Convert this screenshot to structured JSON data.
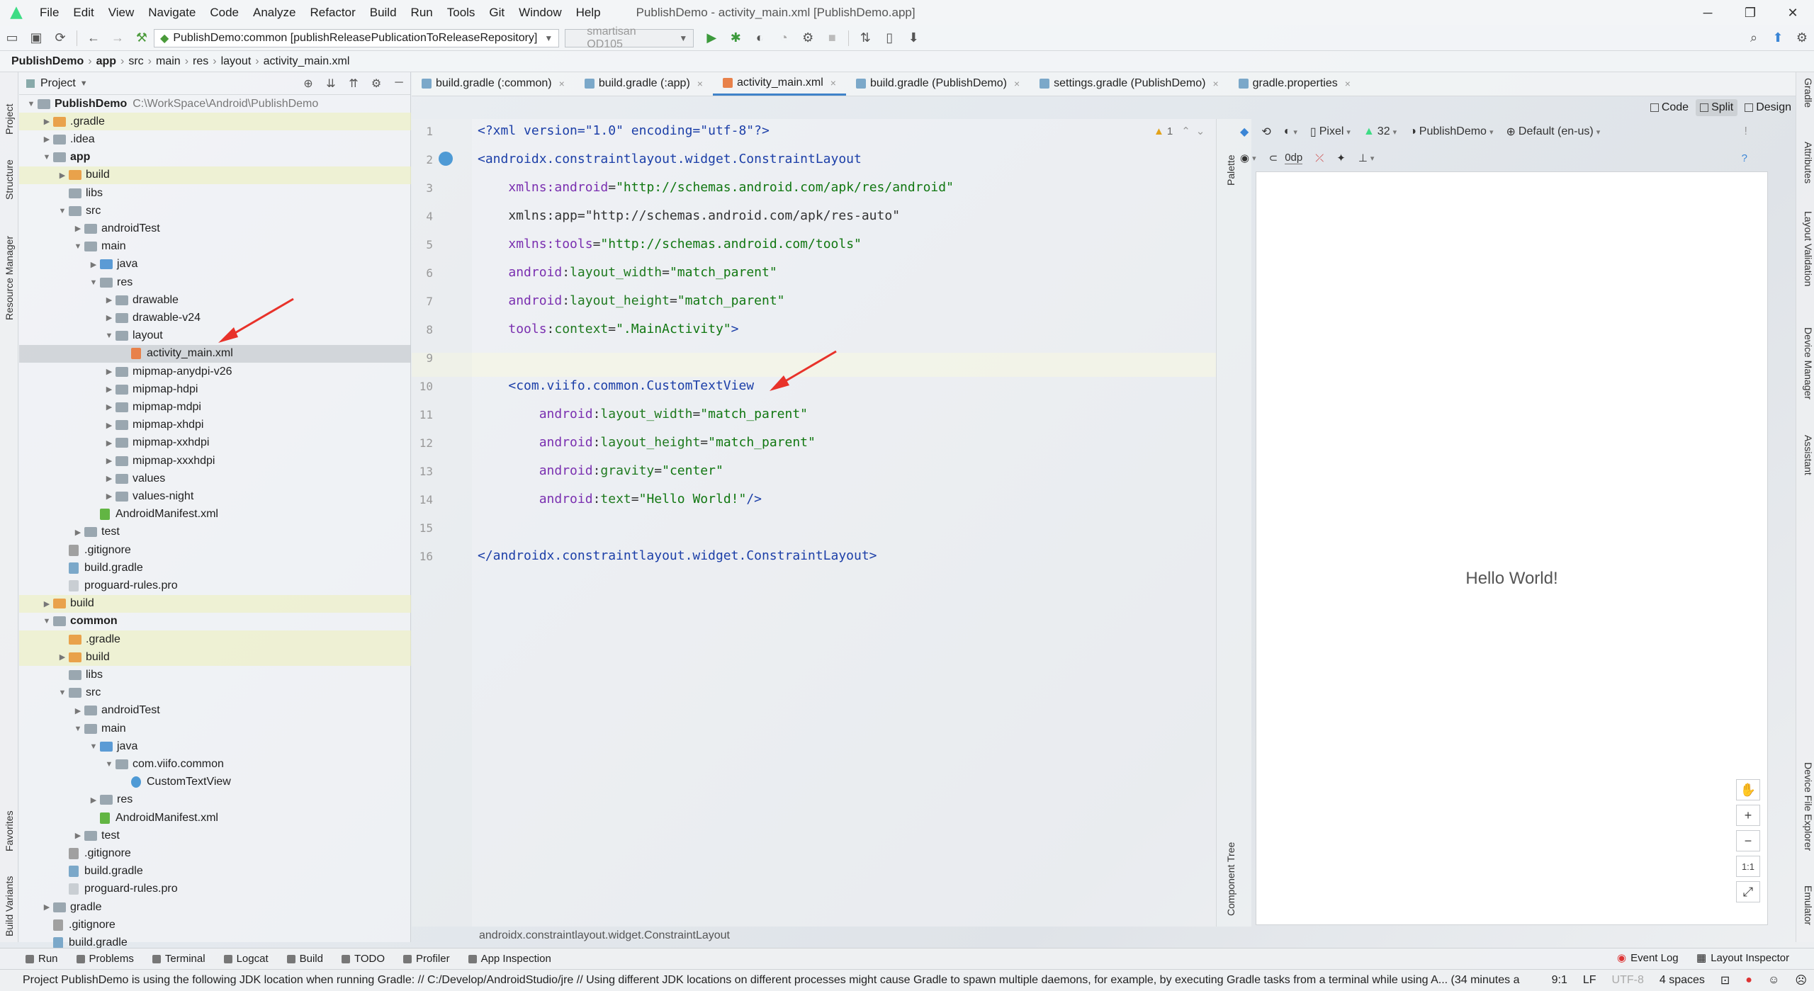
{
  "menubar": {
    "items": [
      "File",
      "Edit",
      "View",
      "Navigate",
      "Code",
      "Analyze",
      "Refactor",
      "Build",
      "Run",
      "Tools",
      "Git",
      "Window",
      "Help"
    ],
    "title": "PublishDemo - activity_main.xml [PublishDemo.app]"
  },
  "toolbar": {
    "run_config": "PublishDemo:common [publishReleasePublicationToReleaseRepository]",
    "device": "smartisan OD105"
  },
  "breadcrumb": [
    "PublishDemo",
    "app",
    "src",
    "main",
    "res",
    "layout",
    "activity_main.xml"
  ],
  "left_tools": [
    "Project",
    "Structure",
    "Resource Manager",
    "Favorites",
    "Build Variants"
  ],
  "right_tools": [
    "Gradle",
    "Attributes",
    "Layout Validation",
    "Device Manager",
    "Assistant",
    "Device File Explorer",
    "Emulator"
  ],
  "project_panel": {
    "title": "Project",
    "tree": [
      {
        "label": "PublishDemo",
        "path": "C:\\WorkSpace\\Android\\PublishDemo",
        "depth": 0,
        "icon": "folder",
        "open": true,
        "bold": true
      },
      {
        "label": ".gradle",
        "depth": 1,
        "icon": "folder-orange",
        "open": false,
        "hl": true
      },
      {
        "label": ".idea",
        "depth": 1,
        "icon": "folder",
        "open": false
      },
      {
        "label": "app",
        "depth": 1,
        "icon": "folder",
        "open": true,
        "bold": true
      },
      {
        "label": "build",
        "depth": 2,
        "icon": "folder-orange",
        "open": false,
        "hl": true
      },
      {
        "label": "libs",
        "depth": 2,
        "icon": "folder",
        "leaf": true
      },
      {
        "label": "src",
        "depth": 2,
        "icon": "folder",
        "open": true
      },
      {
        "label": "androidTest",
        "depth": 3,
        "icon": "folder",
        "open": false
      },
      {
        "label": "main",
        "depth": 3,
        "icon": "folder",
        "open": true
      },
      {
        "label": "java",
        "depth": 4,
        "icon": "folder-blue",
        "open": false
      },
      {
        "label": "res",
        "depth": 4,
        "icon": "folder",
        "open": true
      },
      {
        "label": "drawable",
        "depth": 5,
        "icon": "folder",
        "open": false
      },
      {
        "label": "drawable-v24",
        "depth": 5,
        "icon": "folder",
        "open": false
      },
      {
        "label": "layout",
        "depth": 5,
        "icon": "folder",
        "open": true
      },
      {
        "label": "activity_main.xml",
        "depth": 6,
        "icon": "file-xml",
        "leaf": true,
        "sel": true
      },
      {
        "label": "mipmap-anydpi-v26",
        "depth": 5,
        "icon": "folder",
        "open": false
      },
      {
        "label": "mipmap-hdpi",
        "depth": 5,
        "icon": "folder",
        "open": false
      },
      {
        "label": "mipmap-mdpi",
        "depth": 5,
        "icon": "folder",
        "open": false
      },
      {
        "label": "mipmap-xhdpi",
        "depth": 5,
        "icon": "folder",
        "open": false
      },
      {
        "label": "mipmap-xxhdpi",
        "depth": 5,
        "icon": "folder",
        "open": false
      },
      {
        "label": "mipmap-xxxhdpi",
        "depth": 5,
        "icon": "folder",
        "open": false
      },
      {
        "label": "values",
        "depth": 5,
        "icon": "folder",
        "open": false
      },
      {
        "label": "values-night",
        "depth": 5,
        "icon": "folder",
        "open": false
      },
      {
        "label": "AndroidManifest.xml",
        "depth": 4,
        "icon": "file-manifest",
        "leaf": true
      },
      {
        "label": "test",
        "depth": 3,
        "icon": "folder",
        "open": false
      },
      {
        "label": ".gitignore",
        "depth": 2,
        "icon": "file-git",
        "leaf": true
      },
      {
        "label": "build.gradle",
        "depth": 2,
        "icon": "file-gradle",
        "leaf": true
      },
      {
        "label": "proguard-rules.pro",
        "depth": 2,
        "icon": "file",
        "leaf": true
      },
      {
        "label": "build",
        "depth": 1,
        "icon": "folder-orange",
        "open": false,
        "hl": true
      },
      {
        "label": "common",
        "depth": 1,
        "icon": "folder",
        "open": true,
        "bold": true
      },
      {
        "label": ".gradle",
        "depth": 2,
        "icon": "folder-orange",
        "leaf": true,
        "hl": true
      },
      {
        "label": "build",
        "depth": 2,
        "icon": "folder-orange",
        "open": false,
        "hl": true
      },
      {
        "label": "libs",
        "depth": 2,
        "icon": "folder",
        "leaf": true
      },
      {
        "label": "src",
        "depth": 2,
        "icon": "folder",
        "open": true
      },
      {
        "label": "androidTest",
        "depth": 3,
        "icon": "folder",
        "open": false
      },
      {
        "label": "main",
        "depth": 3,
        "icon": "folder",
        "open": true
      },
      {
        "label": "java",
        "depth": 4,
        "icon": "folder-blue",
        "open": true
      },
      {
        "label": "com.viifo.common",
        "depth": 5,
        "icon": "folder-pkg",
        "open": true
      },
      {
        "label": "CustomTextView",
        "depth": 6,
        "icon": "file-class",
        "leaf": true
      },
      {
        "label": "res",
        "depth": 4,
        "icon": "folder",
        "open": false
      },
      {
        "label": "AndroidManifest.xml",
        "depth": 4,
        "icon": "file-manifest",
        "leaf": true
      },
      {
        "label": "test",
        "depth": 3,
        "icon": "folder",
        "open": false
      },
      {
        "label": ".gitignore",
        "depth": 2,
        "icon": "file-git",
        "leaf": true
      },
      {
        "label": "build.gradle",
        "depth": 2,
        "icon": "file-gradle",
        "leaf": true
      },
      {
        "label": "proguard-rules.pro",
        "depth": 2,
        "icon": "file",
        "leaf": true
      },
      {
        "label": "gradle",
        "depth": 1,
        "icon": "folder",
        "open": false
      },
      {
        "label": ".gitignore",
        "depth": 1,
        "icon": "file-git",
        "leaf": true
      },
      {
        "label": "build.gradle",
        "depth": 1,
        "icon": "file-gradle",
        "leaf": true
      }
    ]
  },
  "editor_tabs": [
    {
      "label": "build.gradle (:common)",
      "icon": "gradle"
    },
    {
      "label": "build.gradle (:app)",
      "icon": "gradle"
    },
    {
      "label": "activity_main.xml",
      "icon": "xml",
      "active": true
    },
    {
      "label": "build.gradle (PublishDemo)",
      "icon": "gradle"
    },
    {
      "label": "settings.gradle (PublishDemo)",
      "icon": "gradle"
    },
    {
      "label": "gradle.properties",
      "icon": "gradle"
    }
  ],
  "code_lines": [
    [
      [
        "c-pi",
        "<?xml version=\"1.0\" encoding=\"utf-8\"?>"
      ]
    ],
    [
      [
        "c-tag",
        "<androidx.constraintlayout.widget.ConstraintLayout"
      ]
    ],
    [
      [
        "c-plain",
        "    "
      ],
      [
        "c-ns",
        "xmlns:android"
      ],
      [
        "c-plain",
        "="
      ],
      [
        "c-str",
        "\"http://schemas.android.com/apk/res/android\""
      ]
    ],
    [
      [
        "c-plain",
        "    xmlns:app=\"http://schemas.android.com/apk/res-auto\""
      ]
    ],
    [
      [
        "c-plain",
        "    "
      ],
      [
        "c-ns",
        "xmlns:tools"
      ],
      [
        "c-plain",
        "="
      ],
      [
        "c-str",
        "\"http://schemas.android.com/tools\""
      ]
    ],
    [
      [
        "c-plain",
        "    "
      ],
      [
        "c-ns",
        "android"
      ],
      [
        "c-plain",
        ":"
      ],
      [
        "c-attr",
        "layout_width"
      ],
      [
        "c-plain",
        "="
      ],
      [
        "c-str",
        "\"match_parent\""
      ]
    ],
    [
      [
        "c-plain",
        "    "
      ],
      [
        "c-ns",
        "android"
      ],
      [
        "c-plain",
        ":"
      ],
      [
        "c-attr",
        "layout_height"
      ],
      [
        "c-plain",
        "="
      ],
      [
        "c-str",
        "\"match_parent\""
      ]
    ],
    [
      [
        "c-plain",
        "    "
      ],
      [
        "c-ns",
        "tools"
      ],
      [
        "c-plain",
        ":"
      ],
      [
        "c-attr",
        "context"
      ],
      [
        "c-plain",
        "="
      ],
      [
        "c-str",
        "\".MainActivity\""
      ],
      [
        "c-tag",
        ">"
      ]
    ],
    [
      [
        "c-plain",
        ""
      ]
    ],
    [
      [
        "c-plain",
        "    "
      ],
      [
        "c-tag",
        "<com.viifo.common.CustomTextView"
      ]
    ],
    [
      [
        "c-plain",
        "        "
      ],
      [
        "c-ns",
        "android"
      ],
      [
        "c-plain",
        ":"
      ],
      [
        "c-attr",
        "layout_width"
      ],
      [
        "c-plain",
        "="
      ],
      [
        "c-str",
        "\"match_parent\""
      ]
    ],
    [
      [
        "c-plain",
        "        "
      ],
      [
        "c-ns",
        "android"
      ],
      [
        "c-plain",
        ":"
      ],
      [
        "c-attr",
        "layout_height"
      ],
      [
        "c-plain",
        "="
      ],
      [
        "c-str",
        "\"match_parent\""
      ]
    ],
    [
      [
        "c-plain",
        "        "
      ],
      [
        "c-ns",
        "android"
      ],
      [
        "c-plain",
        ":"
      ],
      [
        "c-attr",
        "gravity"
      ],
      [
        "c-plain",
        "="
      ],
      [
        "c-str",
        "\"center\""
      ]
    ],
    [
      [
        "c-plain",
        "        "
      ],
      [
        "c-ns",
        "android"
      ],
      [
        "c-plain",
        ":"
      ],
      [
        "c-attr",
        "text"
      ],
      [
        "c-plain",
        "="
      ],
      [
        "c-str",
        "\"Hello World!\""
      ],
      [
        "c-tag",
        "/>"
      ]
    ],
    [
      [
        "c-plain",
        ""
      ]
    ],
    [
      [
        "c-tag",
        "</androidx.constraintlayout.widget.ConstraintLayout>"
      ]
    ]
  ],
  "line_numbers": [
    "1",
    "2",
    "3",
    "4",
    "5",
    "6",
    "7",
    "8",
    "9",
    "10",
    "11",
    "12",
    "13",
    "14",
    "15",
    "16"
  ],
  "warning_count": "1",
  "view_modes": [
    "Code",
    "Split",
    "Design"
  ],
  "side_palette": {
    "palette": "Palette",
    "component_tree": "Component Tree"
  },
  "design_toolbar": {
    "device": "Pixel",
    "api": "32",
    "theme": "PublishDemo",
    "locale": "Default (en-us)",
    "margin": "0dp"
  },
  "preview": {
    "text": "Hello World!"
  },
  "zoom": {
    "plus": "+",
    "minus": "−",
    "ratio": "1:1"
  },
  "editor_crumb": "androidx.constraintlayout.widget.ConstraintLayout",
  "bottom_tools": [
    "Run",
    "Problems",
    "Terminal",
    "Logcat",
    "Build",
    "TODO",
    "Profiler",
    "App Inspection"
  ],
  "bottom_right": {
    "event_log": "Event Log",
    "layout_inspector": "Layout Inspector"
  },
  "status": {
    "message": "Project PublishDemo is using the following JDK location when running Gradle: // C:/Develop/AndroidStudio/jre // Using different JDK locations on different processes might cause Gradle to spawn multiple daemons, for example, by executing Gradle tasks from a terminal while using A... (34 minutes a",
    "position": "9:1",
    "line_sep": "LF",
    "encoding": "UTF-8",
    "indent": "4 spaces"
  },
  "colors": {
    "accent": "#4083c9",
    "arrow": "#e8322a",
    "selection": "#c8ccd0"
  }
}
